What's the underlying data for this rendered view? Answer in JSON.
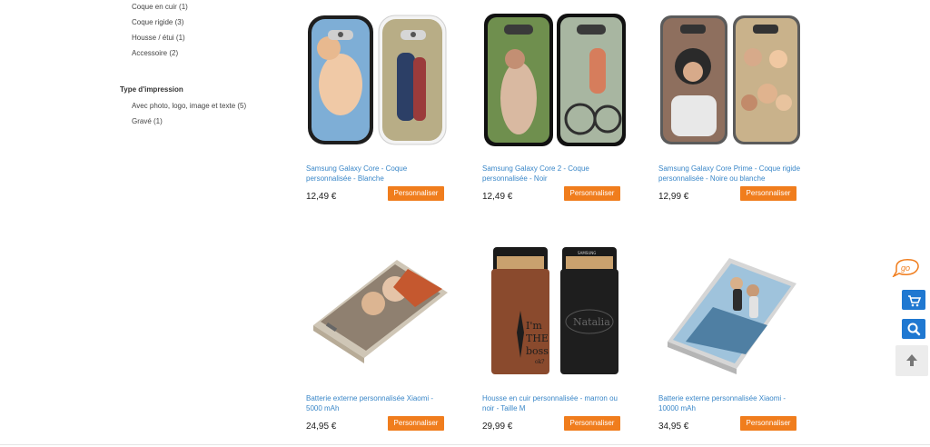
{
  "filters": {
    "type_produit": [
      {
        "label": "Coque en cuir (1)"
      },
      {
        "label": "Coque rigide (3)"
      },
      {
        "label": "Housse / étui (1)"
      },
      {
        "label": "Accessoire (2)"
      }
    ],
    "type_impression_title": "Type d'impression",
    "type_impression": [
      {
        "label": "Avec photo, logo, image et texte (5)"
      },
      {
        "label": "Gravé (1)"
      }
    ]
  },
  "products": [
    {
      "name": "Samsung Galaxy Core - Coque personnalisée - Blanche",
      "price": "12,49 €",
      "cta": "Personnaliser"
    },
    {
      "name": "Samsung Galaxy Core 2 - Coque personnalisée - Noir",
      "price": "12,49 €",
      "cta": "Personnaliser"
    },
    {
      "name": "Samsung Galaxy Core Prime - Coque rigide personnalisée - Noire ou blanche",
      "price": "12,99 €",
      "cta": "Personnaliser"
    },
    {
      "name": "Batterie externe personnalisée Xiaomi - 5000 mAh",
      "price": "24,95 €",
      "cta": "Personnaliser"
    },
    {
      "name": "Housse en cuir personnalisée - marron ou noir - Taille M",
      "price": "29,99 €",
      "cta": "Personnaliser"
    },
    {
      "name": "Batterie externe personnalisée Xiaomi - 10000 mAh",
      "price": "34,95 €",
      "cta": "Personnaliser"
    }
  ],
  "pouch_texts": {
    "left_line1": "I'm",
    "left_line2": "THE",
    "left_line3": "boss",
    "left_line4": "ok?",
    "right": "Natalia",
    "brand": "SAMSUNG"
  },
  "floating_tools": {
    "logo_text": "go"
  },
  "colors": {
    "link": "#3a87c8",
    "cta": "#f07d1d",
    "float_blue": "#1f78d1"
  }
}
